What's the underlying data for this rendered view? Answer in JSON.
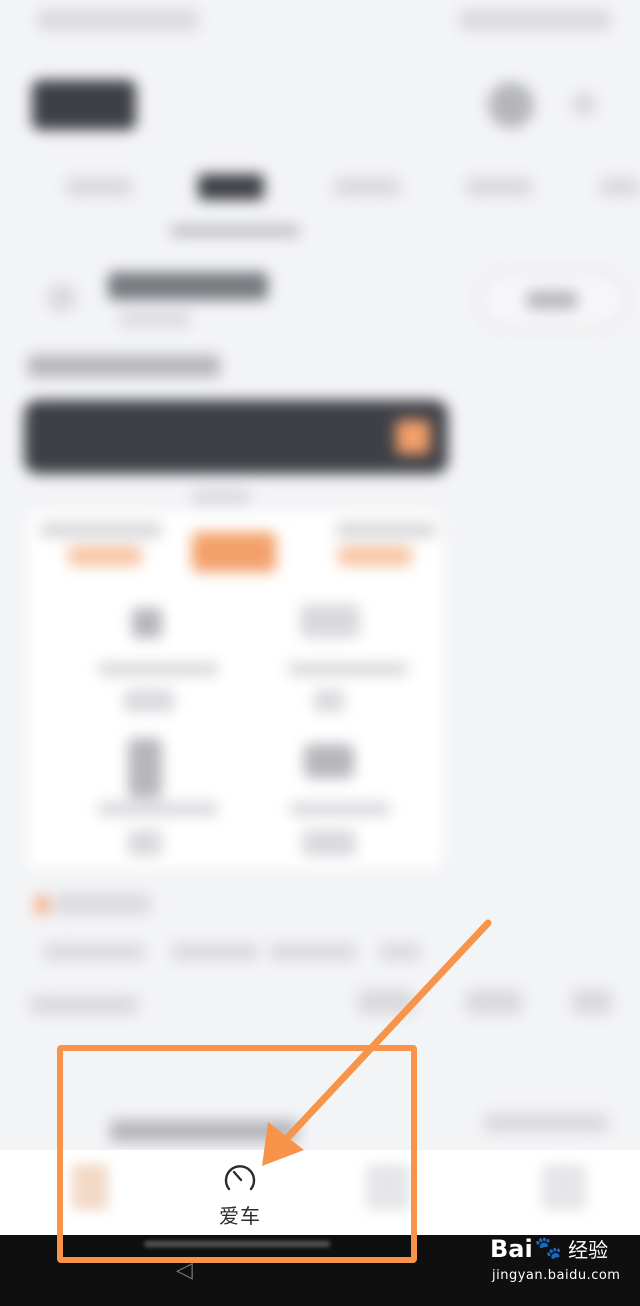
{
  "bottom_nav": {
    "active_tab": {
      "label": "爱车",
      "icon": "speedometer-icon"
    }
  },
  "annotation": {
    "box_color": "#f7944a",
    "arrow_color": "#f7944a"
  },
  "watermark": {
    "brand_left": "Bai",
    "brand_right": "经验",
    "url": "jingyan.baidu.com"
  }
}
